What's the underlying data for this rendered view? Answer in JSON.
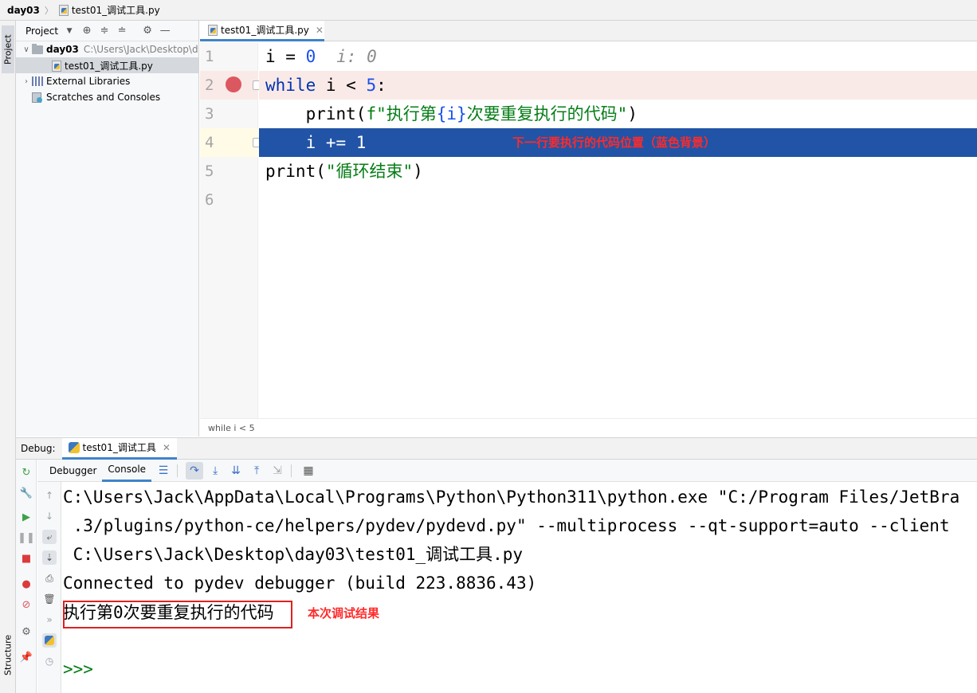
{
  "breadcrumb": {
    "project": "day03",
    "file": "test01_调试工具.py"
  },
  "left_strip": {
    "project_tab": "Project",
    "structure_tab": "Structure"
  },
  "project_panel": {
    "title": "Project",
    "tree": [
      {
        "label": "day03",
        "path": "C:\\Users\\Jack\\Desktop\\d",
        "type": "folder",
        "expanded": true
      },
      {
        "label": "test01_调试工具.py",
        "type": "python-file",
        "selected": true
      },
      {
        "label": "External Libraries",
        "type": "library"
      },
      {
        "label": "Scratches and Consoles",
        "type": "scratches"
      }
    ]
  },
  "editor": {
    "tab_label": "test01_调试工具.py",
    "line_numbers": [
      "1",
      "2",
      "3",
      "4",
      "5",
      "6"
    ],
    "lines": {
      "l1": {
        "var": "i",
        "op": " = ",
        "num": "0",
        "hint": "i: 0"
      },
      "l2": {
        "kw": "while",
        "rest": " i < ",
        "num": "5",
        "colon": ":"
      },
      "l3": {
        "indent": "    ",
        "fn": "print",
        "open": "(",
        "str": "f\"执行第",
        "brace": "{i}",
        "str2": "次要重复执行的代码\"",
        "close": ")"
      },
      "l4": {
        "indent": "    ",
        "text": "i += 1"
      },
      "l5": {
        "fn": "print",
        "open": "(",
        "str": "\"循环结束\"",
        "close": ")"
      }
    },
    "exec_annotation": "下一行要执行的代码位置（蓝色背景）",
    "footer_breadcrumb": "while i < 5"
  },
  "debug": {
    "label": "Debug:",
    "session_tab": "test01_调试工具",
    "tabs": [
      "Debugger",
      "Console"
    ],
    "active_tab": "Console"
  },
  "console": {
    "lines": [
      "C:\\Users\\Jack\\AppData\\Local\\Programs\\Python\\Python311\\python.exe \"C:/Program Files/JetBra",
      " .3/plugins/python-ce/helpers/pydev/pydevd.py\" --multiprocess --qt-support=auto --client",
      " C:\\Users\\Jack\\Desktop\\day03\\test01_调试工具.py",
      "Connected to pydev debugger (build 223.8836.43)",
      "执行第0次要重复执行的代码"
    ],
    "prompt": ">>>",
    "result_annotation": "本次调试结果"
  },
  "colors": {
    "exec_line_bg": "#2154a6",
    "breakpoint": "#db5860",
    "annotation_red": "#ff2a2a",
    "keyword": "#0033b3",
    "string": "#067d17"
  }
}
